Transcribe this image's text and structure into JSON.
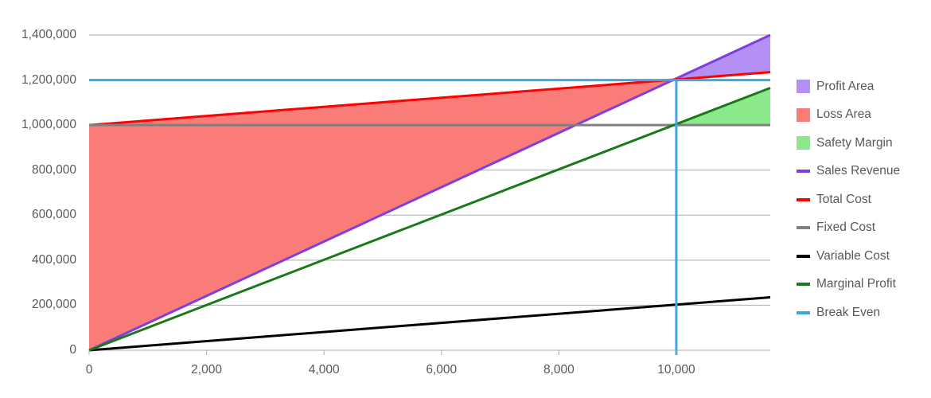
{
  "chart_data": {
    "type": "line",
    "title": "",
    "xlabel": "",
    "ylabel": "",
    "xlim": [
      0,
      11600
    ],
    "ylim": [
      0,
      1400000
    ],
    "x_ticks": [
      0,
      2000,
      4000,
      6000,
      8000,
      10000
    ],
    "x_tick_labels": [
      "0",
      "2,000",
      "4,000",
      "6,000",
      "8,000",
      "10,000"
    ],
    "y_ticks": [
      0,
      200000,
      400000,
      600000,
      800000,
      1000000,
      1200000,
      1400000
    ],
    "y_tick_labels": [
      "0",
      "200,000",
      "400,000",
      "600,000",
      "800,000",
      "1,000,000",
      "1,200,000",
      "1,400,000"
    ],
    "grid": true,
    "legend_position": "right",
    "break_even_point": {
      "x": 10000,
      "y": 1200000
    },
    "series": [
      {
        "name": "Sales Revenue",
        "kind": "line",
        "color": "#7F3FE0",
        "x": [
          0,
          11600
        ],
        "values": [
          0,
          1400000
        ]
      },
      {
        "name": "Total Cost",
        "kind": "line",
        "color": "#FF0000",
        "x": [
          0,
          11600
        ],
        "values": [
          1000000,
          1235000
        ]
      },
      {
        "name": "Fixed Cost",
        "kind": "line",
        "color": "#808080",
        "x": [
          0,
          11600
        ],
        "values": [
          1000000,
          1000000
        ]
      },
      {
        "name": "Variable Cost",
        "kind": "line",
        "color": "#000000",
        "x": [
          0,
          11600
        ],
        "values": [
          0,
          235000
        ]
      },
      {
        "name": "Marginal Profit",
        "kind": "line",
        "color": "#1A7A1A",
        "x": [
          0,
          11600
        ],
        "values": [
          0,
          1165000
        ]
      },
      {
        "name": "Break Even",
        "kind": "reference",
        "color": "#41A5E0",
        "horizontal_y": 1200000,
        "vertical_x": 10000
      }
    ],
    "areas": [
      {
        "name": "Profit Area",
        "color": "#B490F5",
        "between": [
          "Sales Revenue",
          "Total Cost"
        ],
        "x_range": [
          10000,
          11600
        ]
      },
      {
        "name": "Loss Area",
        "color": "#FA7C78",
        "between": [
          "Total Cost",
          "Sales Revenue"
        ],
        "x_range": [
          0,
          10000
        ]
      },
      {
        "name": "Safety Margin",
        "color": "#8BE88B",
        "between": [
          "Marginal Profit",
          "Fixed Cost"
        ],
        "x_range": [
          10000,
          11600
        ]
      }
    ]
  },
  "legend": {
    "items": [
      {
        "label": "Profit Area",
        "color": "#B490F5",
        "marker": "box"
      },
      {
        "label": "Loss Area",
        "color": "#FA7C78",
        "marker": "box"
      },
      {
        "label": "Safety Margin",
        "color": "#8BE88B",
        "marker": "box"
      },
      {
        "label": "Sales Revenue",
        "color": "#7F3FE0",
        "marker": "line"
      },
      {
        "label": "Total Cost",
        "color": "#FF0000",
        "marker": "line"
      },
      {
        "label": "Fixed Cost",
        "color": "#808080",
        "marker": "line"
      },
      {
        "label": "Variable Cost",
        "color": "#000000",
        "marker": "line"
      },
      {
        "label": "Marginal Profit",
        "color": "#1A7A1A",
        "marker": "line"
      },
      {
        "label": "Break Even",
        "color": "#41A5E0",
        "marker": "line"
      }
    ]
  },
  "axes": {
    "y_labels": [
      "1,400,000",
      "1,200,000",
      "1,000,000",
      "800,000",
      "600,000",
      "400,000",
      "200,000",
      "0"
    ],
    "x_labels": [
      "0",
      "2,000",
      "4,000",
      "6,000",
      "8,000",
      "10,000"
    ]
  },
  "colors": {
    "grid": "#ADADAD",
    "axis_text": "#595959",
    "background": "#FFFFFF"
  }
}
